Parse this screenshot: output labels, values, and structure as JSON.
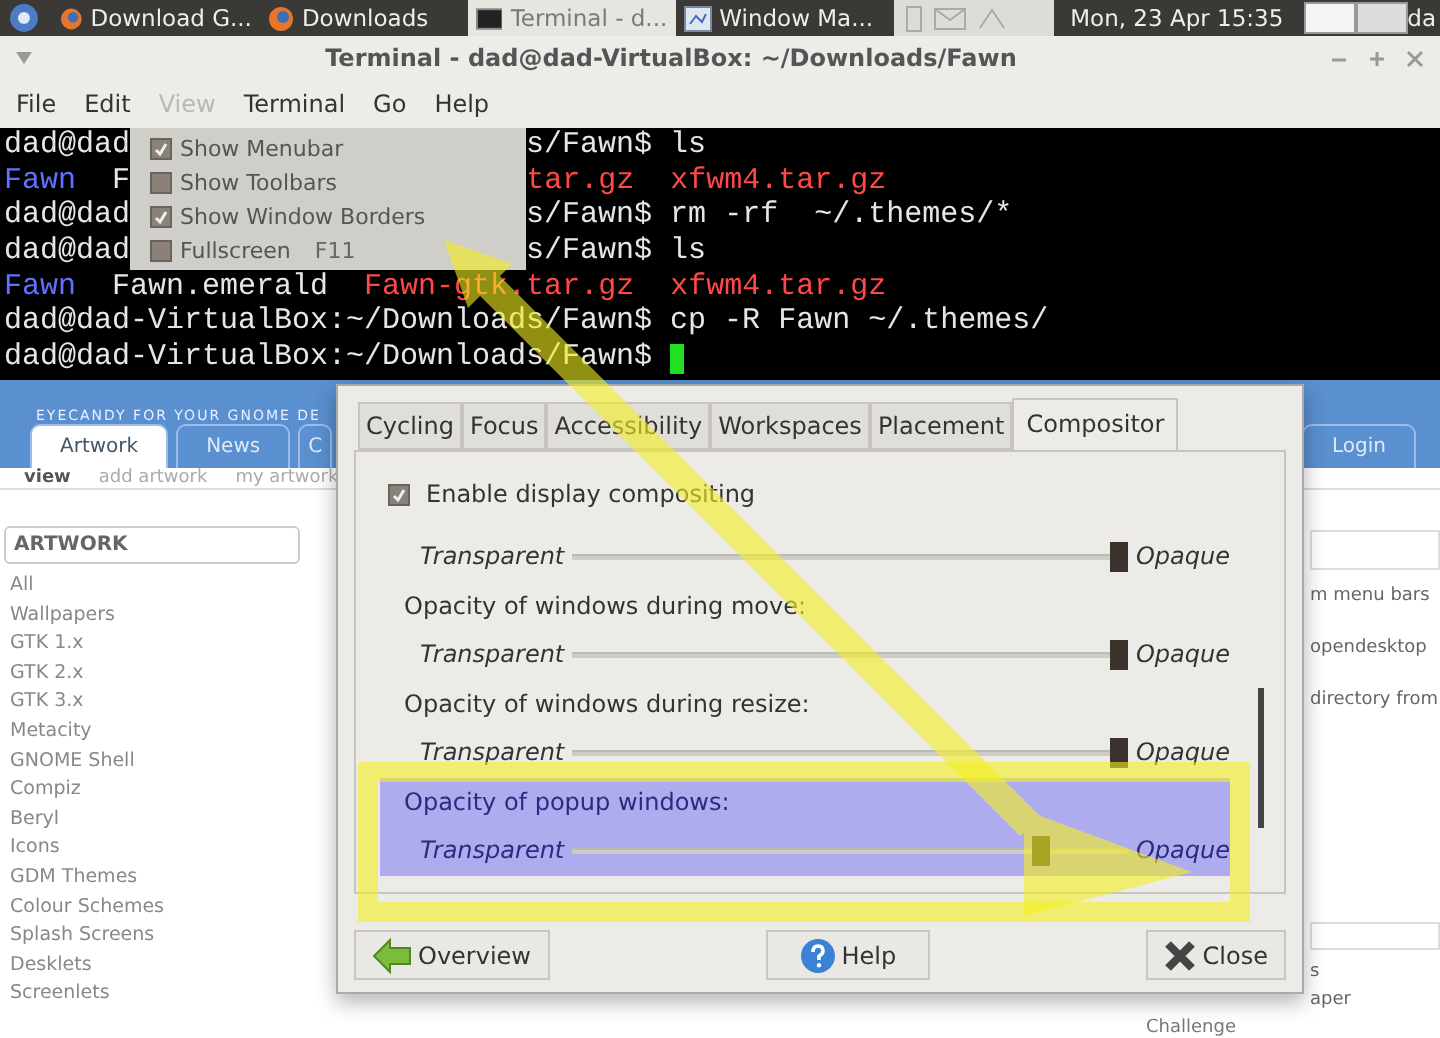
{
  "taskbar": {
    "items": [
      {
        "label": "Download G...",
        "kind": "browser",
        "selected": false
      },
      {
        "label": "Downloads",
        "kind": "browser",
        "selected": false
      },
      {
        "label": "Terminal - d...",
        "kind": "terminal",
        "selected": true
      },
      {
        "label": "Window Ma...",
        "kind": "settings",
        "selected": false
      }
    ],
    "clock": "Mon, 23 Apr  15:35",
    "user": "da"
  },
  "terminal": {
    "title": "Terminal - dad@dad-VirtualBox: ~/Downloads/Fawn",
    "menus": [
      {
        "label": "File",
        "selected": false
      },
      {
        "label": "Edit",
        "selected": false
      },
      {
        "label": "View",
        "selected": true
      },
      {
        "label": "Terminal",
        "selected": false
      },
      {
        "label": "Go",
        "selected": false
      },
      {
        "label": "Help",
        "selected": false
      }
    ],
    "view_menu": [
      {
        "label": "Show Menubar",
        "checked": true
      },
      {
        "label": "Show Toolbars",
        "checked": false
      },
      {
        "label": "Show Window Borders",
        "checked": true
      },
      {
        "label": "Fullscreen",
        "checked": false,
        "shortcut": "F11"
      }
    ],
    "lines": [
      {
        "segments": [
          {
            "kind": "text",
            "text": "dad@dad"
          },
          {
            "kind": "gap"
          },
          {
            "kind": "text",
            "text": "s/Fawn$ ls"
          }
        ]
      },
      {
        "segments": [
          {
            "kind": "dir",
            "text": "Fawn"
          },
          {
            "kind": "text",
            "text": "  F"
          },
          {
            "kind": "gap"
          },
          {
            "kind": "archive",
            "text": "tar.gz  xfwm4.tar.gz"
          }
        ]
      },
      {
        "segments": [
          {
            "kind": "text",
            "text": "dad@dad"
          },
          {
            "kind": "gap"
          },
          {
            "kind": "text",
            "text": "s/Fawn$ rm -rf  ~/.themes/*"
          }
        ]
      },
      {
        "segments": [
          {
            "kind": "text",
            "text": "dad@dad"
          },
          {
            "kind": "gap"
          },
          {
            "kind": "text",
            "text": "s/Fawn$ ls"
          }
        ]
      },
      {
        "segments": [
          {
            "kind": "dir",
            "text": "Fawn"
          },
          {
            "kind": "text",
            "text": "  Fawn.emerald  "
          },
          {
            "kind": "archive",
            "text": "Fawn-gtk.tar.gz  xfwm4.tar.gz"
          }
        ]
      },
      {
        "segments": [
          {
            "kind": "text",
            "text": "dad@dad-VirtualBox:~/Downloads/Fawn$ cp -R Fawn ~/.themes/"
          }
        ]
      },
      {
        "segments": [
          {
            "kind": "text",
            "text": "dad@dad-VirtualBox:~/Downloads/Fawn$ "
          },
          {
            "kind": "cursor"
          }
        ]
      }
    ]
  },
  "web_page": {
    "tagline": "EYECANDY FOR YOUR GNOME DE",
    "tabs": [
      {
        "label": "Artwork",
        "selected": true
      },
      {
        "label": "News",
        "selected": false
      },
      {
        "label": "C",
        "selected": false
      }
    ],
    "login_tab": "Login",
    "subnav": [
      {
        "label": "view",
        "selected": true
      },
      {
        "label": "add artwork",
        "selected": false
      },
      {
        "label": "my artwork",
        "selected": false
      }
    ],
    "sidebar": {
      "title": "ARTWORK",
      "items": [
        "All",
        "Wallpapers",
        "GTK 1.x",
        "GTK 2.x",
        "GTK 3.x",
        "Metacity",
        "GNOME Shell",
        "Compiz",
        "Beryl",
        "Icons",
        "GDM Themes",
        "Colour Schemes",
        "Splash Screens",
        "Desklets",
        "Screenlets"
      ]
    },
    "side_texts": [
      "m menu bars",
      "opendesktop",
      "directory from"
    ],
    "lower_texts": [
      "s",
      "aper"
    ],
    "footer_text": "Challenge"
  },
  "dialog": {
    "tabs": [
      {
        "label": "Cycling",
        "selected": false
      },
      {
        "label": "Focus",
        "selected": false
      },
      {
        "label": "Accessibility",
        "selected": false
      },
      {
        "label": "Workspaces",
        "selected": false
      },
      {
        "label": "Placement",
        "selected": false
      },
      {
        "label": "Compositor",
        "selected": true
      }
    ],
    "compositing": {
      "label": "Enable display compositing",
      "checked": true
    },
    "options": [
      {
        "kind": "slider",
        "min_label": "Transparent",
        "max_label": "Opaque",
        "level": 1,
        "highlighted": false
      },
      {
        "kind": "heading",
        "text": "Opacity of windows during move:",
        "highlighted": false
      },
      {
        "kind": "slider",
        "min_label": "Transparent",
        "max_label": "Opaque",
        "level": 1,
        "highlighted": false
      },
      {
        "kind": "heading",
        "text": "Opacity of windows during resize:",
        "highlighted": false
      },
      {
        "kind": "slider",
        "min_label": "Transparent",
        "max_label": "Opaque",
        "level": 1,
        "highlighted": false
      },
      {
        "kind": "heading",
        "text": "Opacity of popup windows:",
        "highlighted": true
      },
      {
        "kind": "slider",
        "min_label": "Transparent",
        "max_label": "Opaque",
        "level": 0.86,
        "highlighted": true
      }
    ],
    "buttons": [
      {
        "label": "Overview",
        "kind": "back"
      },
      {
        "label": "Help",
        "kind": "help"
      },
      {
        "label": "Close",
        "kind": "close"
      }
    ]
  }
}
